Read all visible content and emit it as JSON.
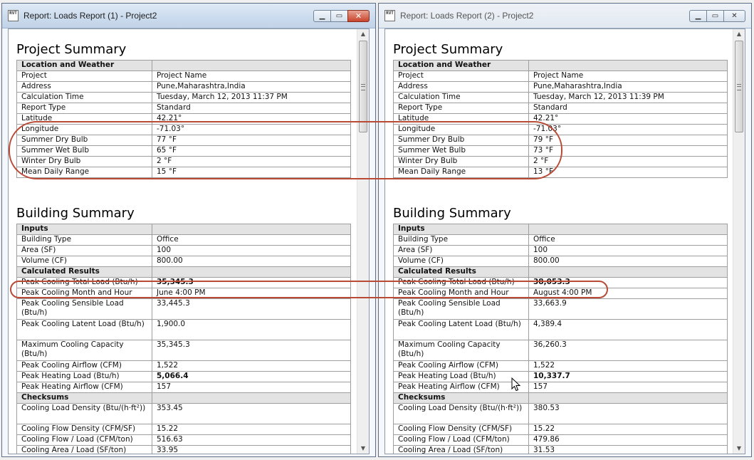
{
  "windows": [
    {
      "title": "Report: Loads Report (1) - Project2",
      "icon_label": "RVT",
      "project_summary": {
        "heading": "Project Summary",
        "section": "Location and Weather",
        "rows": [
          [
            "Project",
            "Project Name"
          ],
          [
            "Address",
            "Pune,Maharashtra,India"
          ],
          [
            "Calculation Time",
            "Tuesday, March 12, 2013 11:37 PM"
          ],
          [
            "Report Type",
            "Standard"
          ],
          [
            "Latitude",
            "42.21°"
          ],
          [
            "Longitude",
            "-71.03°"
          ],
          [
            "Summer Dry Bulb",
            "77 °F"
          ],
          [
            "Summer Wet Bulb",
            "65 °F"
          ],
          [
            "Winter Dry Bulb",
            "2 °F"
          ],
          [
            "Mean Daily Range",
            "15 °F"
          ]
        ]
      },
      "building_summary": {
        "heading": "Building Summary",
        "inputs_label": "Inputs",
        "inputs": [
          [
            "Building Type",
            "Office"
          ],
          [
            "Area (SF)",
            "100"
          ],
          [
            "Volume (CF)",
            "800.00"
          ]
        ],
        "calc_label": "Calculated Results",
        "calc": [
          [
            "Peak Cooling Total Load (Btu/h)",
            "35,345.3"
          ],
          [
            "Peak Cooling Month and Hour",
            "June 4:00 PM"
          ],
          [
            "Peak Cooling Sensible Load (Btu/h)",
            "33,445.3"
          ],
          [
            "Peak Cooling Latent Load (Btu/h)",
            "1,900.0"
          ],
          [
            "Maximum Cooling Capacity (Btu/h)",
            "35,345.3"
          ],
          [
            "Peak Cooling Airflow (CFM)",
            "1,522"
          ],
          [
            "Peak Heating Load (Btu/h)",
            "5,066.4"
          ],
          [
            "Peak Heating Airflow (CFM)",
            "157"
          ]
        ],
        "check_label": "Checksums",
        "checks": [
          [
            "Cooling Load Density (Btu/(h·ft²))",
            "353.45"
          ],
          [
            "Cooling Flow Density (CFM/SF)",
            "15.22"
          ],
          [
            "Cooling Flow / Load (CFM/ton)",
            "516.63"
          ],
          [
            "Cooling Area / Load (SF/ton)",
            "33.95"
          ]
        ]
      }
    },
    {
      "title": "Report: Loads Report (2) - Project2",
      "icon_label": "RVT",
      "project_summary": {
        "heading": "Project Summary",
        "section": "Location and Weather",
        "rows": [
          [
            "Project",
            "Project Name"
          ],
          [
            "Address",
            "Pune,Maharashtra,India"
          ],
          [
            "Calculation Time",
            "Tuesday, March 12, 2013 11:39 PM"
          ],
          [
            "Report Type",
            "Standard"
          ],
          [
            "Latitude",
            "42.21°"
          ],
          [
            "Longitude",
            "-71.03°"
          ],
          [
            "Summer Dry Bulb",
            "79 °F"
          ],
          [
            "Summer Wet Bulb",
            "73 °F"
          ],
          [
            "Winter Dry Bulb",
            "2 °F"
          ],
          [
            "Mean Daily Range",
            "13 °F"
          ]
        ]
      },
      "building_summary": {
        "heading": "Building Summary",
        "inputs_label": "Inputs",
        "inputs": [
          [
            "Building Type",
            "Office"
          ],
          [
            "Area (SF)",
            "100"
          ],
          [
            "Volume (CF)",
            "800.00"
          ]
        ],
        "calc_label": "Calculated Results",
        "calc": [
          [
            "Peak Cooling Total Load (Btu/h)",
            "38,053.3"
          ],
          [
            "Peak Cooling Month and Hour",
            "August 4:00 PM"
          ],
          [
            "Peak Cooling Sensible Load (Btu/h)",
            "33,663.9"
          ],
          [
            "Peak Cooling Latent Load (Btu/h)",
            "4,389.4"
          ],
          [
            "Maximum Cooling Capacity (Btu/h)",
            "36,260.3"
          ],
          [
            "Peak Cooling Airflow (CFM)",
            "1,522"
          ],
          [
            "Peak Heating Load (Btu/h)",
            "10,337.7"
          ],
          [
            "Peak Heating Airflow (CFM)",
            "157"
          ]
        ],
        "check_label": "Checksums",
        "checks": [
          [
            "Cooling Load Density (Btu/(h·ft²))",
            "380.53"
          ],
          [
            "Cooling Flow Density (CFM/SF)",
            "15.22"
          ],
          [
            "Cooling Flow / Load (CFM/ton)",
            "479.86"
          ],
          [
            "Cooling Area / Load (SF/ton)",
            "31.53"
          ]
        ]
      }
    }
  ],
  "colors": {
    "highlight": "#b94a36",
    "header_row": "#e3e3e3"
  }
}
